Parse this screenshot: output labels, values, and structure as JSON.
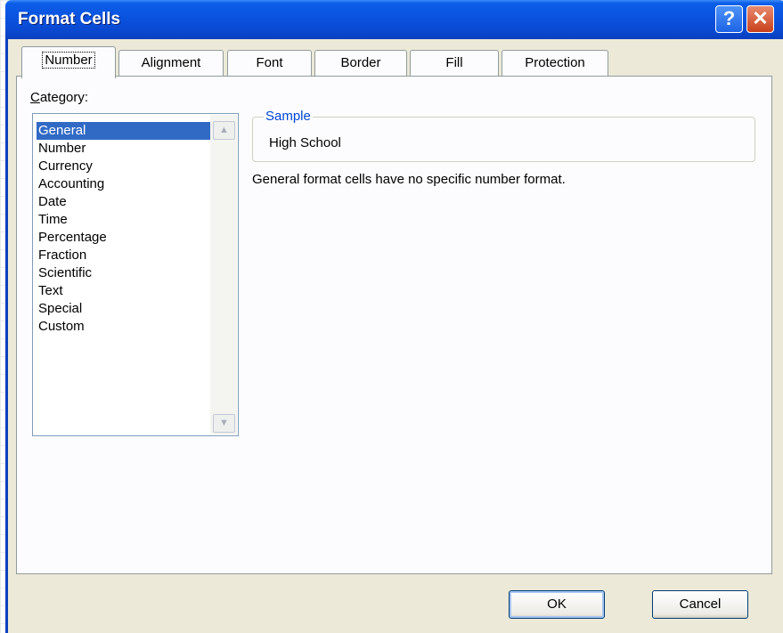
{
  "window": {
    "title": "Format Cells",
    "help_symbol": "?",
    "close_symbol": "✕"
  },
  "tabs": [
    {
      "label": "Number"
    },
    {
      "label": "Alignment"
    },
    {
      "label": "Font"
    },
    {
      "label": "Border"
    },
    {
      "label": "Fill"
    },
    {
      "label": "Protection"
    }
  ],
  "number_tab": {
    "category_label_accel": "C",
    "category_label_rest": "ategory:",
    "categories": [
      "General",
      "Number",
      "Currency",
      "Accounting",
      "Date",
      "Time",
      "Percentage",
      "Fraction",
      "Scientific",
      "Text",
      "Special",
      "Custom"
    ],
    "selected_category": "General",
    "sample": {
      "legend": "Sample",
      "value": "High School"
    },
    "description": "General format cells have no specific number format."
  },
  "buttons": {
    "ok": "OK",
    "cancel": "Cancel"
  },
  "icons": {
    "help": "question-mark-icon",
    "close": "close-x-icon",
    "scroll_up": "chevron-up-icon",
    "scroll_down": "chevron-down-icon"
  },
  "colors": {
    "titlebar": "#0a53df",
    "selection": "#316ac5",
    "sample_legend": "#0046d5",
    "dialog_face": "#ece9d8"
  }
}
